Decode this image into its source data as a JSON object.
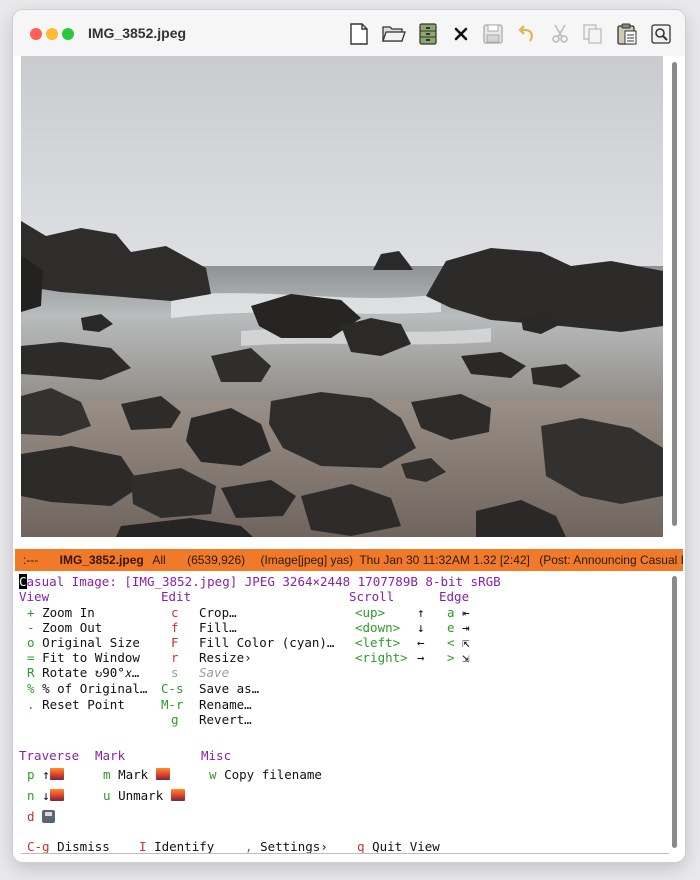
{
  "window": {
    "title": "IMG_3852.jpeg"
  },
  "toolbar": {
    "icons": [
      "new-file-icon",
      "open-folder-icon",
      "dired-cabinet-icon",
      "close-x-icon",
      "save-disk-icon",
      "undo-icon",
      "cut-scissors-icon",
      "copy-icon",
      "paste-clipboard-icon",
      "preferences-icon"
    ]
  },
  "modeline": {
    "status": ":---",
    "buffer": "IMG_3852.jpeg",
    "position": "All",
    "coords": "(6539,926)",
    "mode": "(Image[jpeg] yas)",
    "time": "Thu Jan 30 11:32AM 1.32 [2:42]",
    "post": "(Post: Announcing Casual I"
  },
  "transient": {
    "header": {
      "cursor": "C",
      "text": "asual Image: [IMG_3852.jpeg] JPEG 3264×2448 1707789B 8-bit sRGB"
    },
    "view": {
      "heading": "View",
      "items": [
        {
          "key": "+",
          "label": "Zoom In"
        },
        {
          "key": "-",
          "label": "Zoom Out"
        },
        {
          "key": "o",
          "label": "Original Size"
        },
        {
          "key": "=",
          "label": "Fit to Window"
        },
        {
          "key": "R",
          "label": "Rotate ↻90°𝑥…"
        },
        {
          "key": "%",
          "label": "% of Original…"
        },
        {
          "key": ".",
          "label": "Reset Point"
        }
      ]
    },
    "edit": {
      "heading": "Edit",
      "items": [
        {
          "key": "c",
          "label": "Crop…"
        },
        {
          "key": "f",
          "label": "Fill…"
        },
        {
          "key": "F",
          "label": "Fill Color (cyan)…"
        },
        {
          "key": "r",
          "label": "Resize›"
        },
        {
          "key": "s",
          "label": "Save"
        },
        {
          "key": "C-s",
          "label": "Save as…"
        },
        {
          "key": "M-r",
          "label": "Rename…"
        },
        {
          "key": "g",
          "label": "Revert…"
        }
      ]
    },
    "scroll": {
      "heading": "Scroll",
      "items": [
        {
          "key": "<up>",
          "label": "↑"
        },
        {
          "key": "<down>",
          "label": "↓"
        },
        {
          "key": "<left>",
          "label": "←"
        },
        {
          "key": "<right>",
          "label": "→"
        }
      ]
    },
    "edge": {
      "heading": "Edge",
      "items": [
        {
          "key": "a",
          "label": "⇤"
        },
        {
          "key": "e",
          "label": "⇥"
        },
        {
          "key": "<",
          "label": "⇱"
        },
        {
          "key": ">",
          "label": "⇲"
        }
      ]
    },
    "traverse": {
      "heading": "Traverse",
      "items": [
        {
          "key": "p",
          "label": "↑"
        },
        {
          "key": "n",
          "label": "↓"
        },
        {
          "key": "d",
          "label": ""
        }
      ]
    },
    "mark": {
      "heading": "Mark",
      "items": [
        {
          "key": "m",
          "label": "Mark"
        },
        {
          "key": "u",
          "label": "Unmark"
        }
      ]
    },
    "misc": {
      "heading": "Misc",
      "items": [
        {
          "key": "w",
          "label": "Copy filename"
        }
      ]
    },
    "footer": [
      {
        "key": "C-g",
        "label": "Dismiss"
      },
      {
        "key": "I",
        "label": "Identify"
      },
      {
        "key": ",",
        "label": "Settings›"
      },
      {
        "key": "q",
        "label": "Quit View"
      }
    ]
  },
  "colors": {
    "modeline_bg": "#f07a2a",
    "heading": "#8b1fa8",
    "key": "#2f9b2a",
    "footer_key": "#c8342c"
  }
}
